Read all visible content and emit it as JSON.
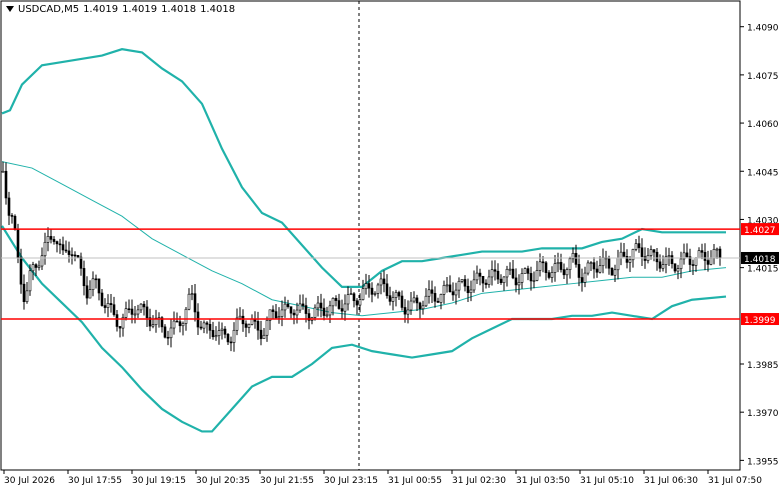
{
  "header": {
    "symbol": "USDCAD,M5",
    "open": "1.4019",
    "high": "1.4019",
    "low": "1.4018",
    "close": "1.4018"
  },
  "colors": {
    "background": "#ffffff",
    "candle": "#000000",
    "bands": "#20b2aa",
    "level_line": "#ff0000",
    "price_tag": "#ff0000",
    "current_tag": "#000000"
  },
  "chart_data": {
    "type": "candlestick",
    "y_ticks": [
      "1.4090",
      "1.4075",
      "1.4060",
      "1.4045",
      "1.4030",
      "1.4015",
      "1.3985",
      "1.3970",
      "1.3955"
    ],
    "x_ticks": [
      "30 Jul 2026",
      "30 Jul 17:55",
      "30 Jul 19:15",
      "30 Jul 20:35",
      "30 Jul 21:55",
      "30 Jul 23:15",
      "31 Jul 00:55",
      "31 Jul 02:30",
      "31 Jul 03:50",
      "31 Jul 05:10",
      "31 Jul 06:30",
      "31 Jul 07:50"
    ],
    "ylim": [
      1.3952,
      1.4098
    ],
    "levels": [
      {
        "label": "1.4027",
        "value": 1.4027
      },
      {
        "label": "1.3999",
        "value": 1.3999
      }
    ],
    "current_price": {
      "label": "1.4018",
      "value": 1.4018
    },
    "upper_band": [
      [
        0,
        1.4063
      ],
      [
        8,
        1.4064
      ],
      [
        20,
        1.4072
      ],
      [
        40,
        1.4078
      ],
      [
        60,
        1.4079
      ],
      [
        80,
        1.408
      ],
      [
        100,
        1.4081
      ],
      [
        120,
        1.4083
      ],
      [
        140,
        1.4082
      ],
      [
        160,
        1.4077
      ],
      [
        180,
        1.4073
      ],
      [
        200,
        1.4066
      ],
      [
        220,
        1.4052
      ],
      [
        240,
        1.404
      ],
      [
        260,
        1.4032
      ],
      [
        280,
        1.4029
      ],
      [
        300,
        1.4022
      ],
      [
        320,
        1.4015
      ],
      [
        340,
        1.4009
      ],
      [
        360,
        1.4009
      ],
      [
        380,
        1.4014
      ],
      [
        400,
        1.4017
      ],
      [
        420,
        1.4017
      ],
      [
        440,
        1.4018
      ],
      [
        460,
        1.4019
      ],
      [
        480,
        1.402
      ],
      [
        500,
        1.402
      ],
      [
        520,
        1.402
      ],
      [
        540,
        1.4021
      ],
      [
        560,
        1.4021
      ],
      [
        580,
        1.4021
      ],
      [
        600,
        1.4023
      ],
      [
        620,
        1.4024
      ],
      [
        640,
        1.4027
      ],
      [
        660,
        1.4026
      ],
      [
        680,
        1.4026
      ],
      [
        700,
        1.4026
      ],
      [
        724,
        1.4026
      ]
    ],
    "middle_band": [
      [
        0,
        1.4048
      ],
      [
        30,
        1.4046
      ],
      [
        60,
        1.4041
      ],
      [
        90,
        1.4036
      ],
      [
        120,
        1.4031
      ],
      [
        150,
        1.4024
      ],
      [
        180,
        1.4019
      ],
      [
        210,
        1.4014
      ],
      [
        240,
        1.401
      ],
      [
        270,
        1.4005
      ],
      [
        300,
        1.4003
      ],
      [
        330,
        1.4001
      ],
      [
        360,
        1.4
      ],
      [
        390,
        1.4001
      ],
      [
        420,
        1.4002
      ],
      [
        450,
        1.4004
      ],
      [
        480,
        1.4007
      ],
      [
        510,
        1.4008
      ],
      [
        540,
        1.4009
      ],
      [
        570,
        1.401
      ],
      [
        600,
        1.4011
      ],
      [
        630,
        1.4012
      ],
      [
        660,
        1.4012
      ],
      [
        690,
        1.4014
      ],
      [
        724,
        1.4015
      ]
    ],
    "lower_band": [
      [
        0,
        1.4028
      ],
      [
        20,
        1.4018
      ],
      [
        40,
        1.401
      ],
      [
        60,
        1.4004
      ],
      [
        80,
        1.3998
      ],
      [
        100,
        1.399
      ],
      [
        120,
        1.3984
      ],
      [
        140,
        1.3977
      ],
      [
        160,
        1.3971
      ],
      [
        180,
        1.3967
      ],
      [
        200,
        1.3964
      ],
      [
        210,
        1.3964
      ],
      [
        230,
        1.3971
      ],
      [
        250,
        1.3978
      ],
      [
        270,
        1.3981
      ],
      [
        290,
        1.3981
      ],
      [
        310,
        1.3985
      ],
      [
        330,
        1.399
      ],
      [
        350,
        1.3991
      ],
      [
        370,
        1.3989
      ],
      [
        390,
        1.3988
      ],
      [
        410,
        1.3987
      ],
      [
        430,
        1.3988
      ],
      [
        450,
        1.3989
      ],
      [
        470,
        1.3993
      ],
      [
        490,
        1.3996
      ],
      [
        510,
        1.3999
      ],
      [
        530,
        1.3999
      ],
      [
        550,
        1.3999
      ],
      [
        570,
        1.4
      ],
      [
        590,
        1.4
      ],
      [
        610,
        1.4001
      ],
      [
        630,
        1.4
      ],
      [
        650,
        1.3999
      ],
      [
        670,
        1.4003
      ],
      [
        690,
        1.4005
      ],
      [
        724,
        1.4006
      ]
    ],
    "close_path": [
      [
        0,
        1.4045
      ],
      [
        6,
        1.4033
      ],
      [
        10,
        1.4029
      ],
      [
        16,
        1.4015
      ],
      [
        22,
        1.4005
      ],
      [
        28,
        1.4013
      ],
      [
        36,
        1.4018
      ],
      [
        44,
        1.4022
      ],
      [
        52,
        1.4026
      ],
      [
        60,
        1.4018
      ],
      [
        68,
        1.4022
      ],
      [
        76,
        1.4015
      ],
      [
        84,
        1.4008
      ],
      [
        92,
        1.401
      ],
      [
        100,
        1.4005
      ],
      [
        108,
        1.4001
      ],
      [
        116,
        1.3998
      ],
      [
        124,
        1.4
      ],
      [
        132,
        1.4003
      ],
      [
        140,
        1.4001
      ],
      [
        148,
        1.3999
      ],
      [
        156,
        1.3997
      ],
      [
        164,
        1.3995
      ],
      [
        172,
        1.3996
      ],
      [
        180,
        1.4
      ],
      [
        188,
        1.4006
      ],
      [
        196,
        1.3998
      ],
      [
        204,
        1.3995
      ],
      [
        212,
        1.3996
      ],
      [
        220,
        1.3993
      ],
      [
        228,
        1.3994
      ],
      [
        236,
        1.3998
      ],
      [
        244,
        1.3999
      ],
      [
        252,
        1.3996
      ],
      [
        260,
        1.3995
      ],
      [
        268,
        1.4
      ],
      [
        276,
        1.4002
      ],
      [
        284,
        1.4001
      ],
      [
        292,
        1.4003
      ],
      [
        300,
        1.4001
      ],
      [
        310,
        1.4001
      ],
      [
        320,
        1.4002
      ],
      [
        330,
        1.4003
      ],
      [
        340,
        1.4004
      ],
      [
        350,
        1.4005
      ],
      [
        360,
        1.4007
      ],
      [
        370,
        1.4009
      ],
      [
        380,
        1.4009
      ],
      [
        390,
        1.4006
      ],
      [
        400,
        1.4003
      ],
      [
        410,
        1.4003
      ],
      [
        420,
        1.4005
      ],
      [
        430,
        1.4006
      ],
      [
        440,
        1.4007
      ],
      [
        450,
        1.4009
      ],
      [
        460,
        1.4009
      ],
      [
        470,
        1.401
      ],
      [
        480,
        1.4012
      ],
      [
        490,
        1.4012
      ],
      [
        500,
        1.4013
      ],
      [
        510,
        1.4012
      ],
      [
        520,
        1.4012
      ],
      [
        530,
        1.4013
      ],
      [
        540,
        1.4015
      ],
      [
        550,
        1.4014
      ],
      [
        560,
        1.4015
      ],
      [
        570,
        1.4017
      ],
      [
        580,
        1.4012
      ],
      [
        590,
        1.4016
      ],
      [
        600,
        1.4016
      ],
      [
        610,
        1.4015
      ],
      [
        620,
        1.4018
      ],
      [
        630,
        1.402
      ],
      [
        640,
        1.402
      ],
      [
        650,
        1.4018
      ],
      [
        660,
        1.4017
      ],
      [
        670,
        1.4016
      ],
      [
        680,
        1.4017
      ],
      [
        690,
        1.4018
      ],
      [
        700,
        1.4018
      ],
      [
        710,
        1.4019
      ],
      [
        718,
        1.4018
      ]
    ]
  }
}
